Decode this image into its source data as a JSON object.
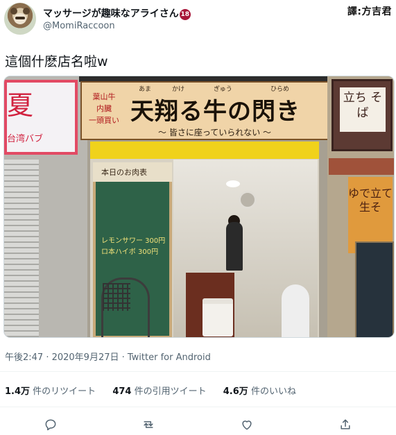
{
  "header": {
    "display_name": "マッサージが趣味なアライさん",
    "age_badge": "18",
    "handle": "@MomiRaccoon",
    "translator_credit": "譯:方吉君"
  },
  "tweet": {
    "text": "這個什麽店名啦w"
  },
  "photo": {
    "left_sign_kanji": "夏",
    "left_sign_text": "台湾バブ",
    "side_text": [
      "葉山牛",
      "内臓",
      "一頭買い"
    ],
    "ruby": [
      "あま",
      "かけ",
      "ぎゅう",
      "ひらめ"
    ],
    "main_title": "天翔る牛の閃き",
    "subtitle": "〜 皆さに座っていられない 〜",
    "board_title": "本日のお肉表",
    "board_lines": [
      "レモンサワー 300円",
      "ロ本ハイボ 300円"
    ],
    "right_sign": "立ち そば",
    "noren_text": "ゆで立て生そ"
  },
  "meta": {
    "timestamp": "午後2:47 · 2020年9月27日 · Twitter for Android"
  },
  "stats": {
    "retweets_count": "1.4万",
    "retweets_label": "件のリツイート",
    "quotes_count": "474",
    "quotes_label": "件の引用ツイート",
    "likes_count": "4.6万",
    "likes_label": "件のいいね"
  },
  "actions": {
    "icons": [
      "reply-icon",
      "retweet-icon",
      "like-icon",
      "share-icon"
    ],
    "icon_color": "#536471"
  }
}
